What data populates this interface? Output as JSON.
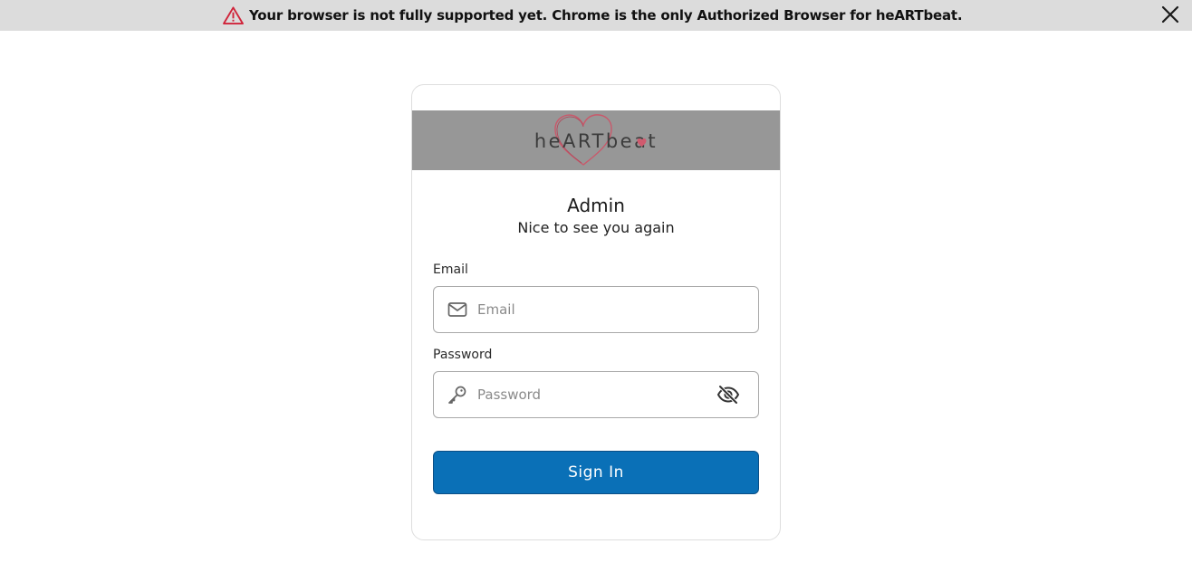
{
  "banner": {
    "message": "Your browser is not fully supported yet. Chrome is the only Authorized Browser for heARTbeat.",
    "icon": "warning-triangle-icon",
    "close_icon": "close-icon",
    "icon_color": "#d0243a"
  },
  "logo": {
    "text": "heARTbeat",
    "accent_color": "#d05a6e"
  },
  "login": {
    "title": "Admin",
    "subtitle": "Nice to see you again",
    "email_label": "Email",
    "email_placeholder": "Email",
    "email_value": "",
    "email_icon": "envelope-icon",
    "password_label": "Password",
    "password_placeholder": "Password",
    "password_value": "",
    "password_icon": "key-icon",
    "visibility_icon": "eye-slash-icon",
    "submit_label": "Sign In",
    "submit_color": "#0a70b7"
  }
}
